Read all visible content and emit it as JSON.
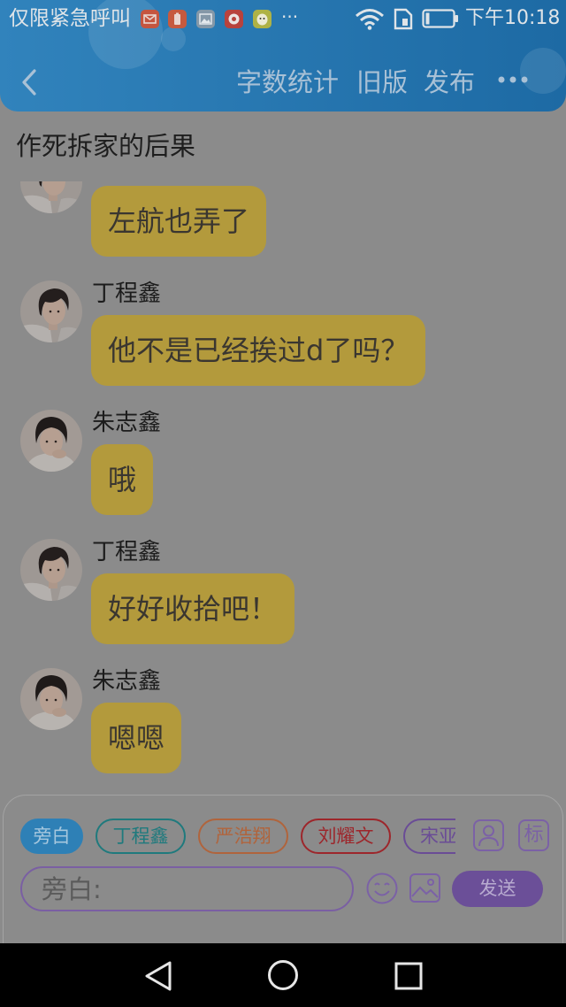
{
  "status_bar": {
    "carrier_text": "仅限紧急呼叫",
    "notification_icons": [
      {
        "icon": "mail-app-icon",
        "color": "#c5553f"
      },
      {
        "icon": "battery-app-icon",
        "color": "#c65a3f"
      },
      {
        "icon": "gallery-app-icon",
        "color": "#8598a8"
      },
      {
        "icon": "red-app-icon",
        "color": "#b8423d"
      },
      {
        "icon": "yellow-app-icon",
        "color": "#aeb246"
      }
    ],
    "more_text": "···",
    "wifi_icon": "wifi-icon",
    "sim_icon": "sim-card-icon",
    "battery_icon": "battery-icon",
    "time": "下午10:18"
  },
  "header": {
    "back_icon": "chevron-left-icon",
    "word_count_label": "字数统计",
    "old_version_label": "旧版",
    "publish_label": "发布",
    "more_icon": "more-dots-icon",
    "gradient_colors": [
      "#3183bc",
      "#1d6aa4"
    ]
  },
  "title": "作死拆家的后果",
  "theme": {
    "background": "#8b8b8b",
    "bubble_color": "#b39a3c"
  },
  "messages": [
    {
      "text": "左航也弄了"
    },
    {
      "speaker": "丁程鑫",
      "text": "他不是已经挨过d了吗？"
    },
    {
      "speaker": "朱志鑫",
      "text": "哦"
    },
    {
      "speaker": "丁程鑫",
      "text": "好好收拾吧！"
    },
    {
      "speaker": "朱志鑫",
      "text": "嗯嗯"
    }
  ],
  "composer": {
    "roles": [
      {
        "label": "旁白",
        "color": "#2e80b6",
        "selected": true
      },
      {
        "label": "丁程鑫",
        "color": "#1f7a7d",
        "selected": false
      },
      {
        "label": "严浩翔",
        "color": "#b0643c",
        "selected": false
      },
      {
        "label": "刘耀文",
        "color": "#9d262b",
        "selected": false
      },
      {
        "label": "宋亚",
        "color": "#6a4c96",
        "selected": false
      }
    ],
    "role_manager_icon": "person-icon",
    "tag_label": "标",
    "input_placeholder": "旁白:",
    "emoji_icon": "emoji-icon",
    "image_icon": "image-icon",
    "send_label": "发送",
    "accent_color": "#7b61a6"
  },
  "system_nav": {
    "back_icon": "back-triangle-icon",
    "home_icon": "home-circle-icon",
    "recents_icon": "recents-square-icon"
  }
}
